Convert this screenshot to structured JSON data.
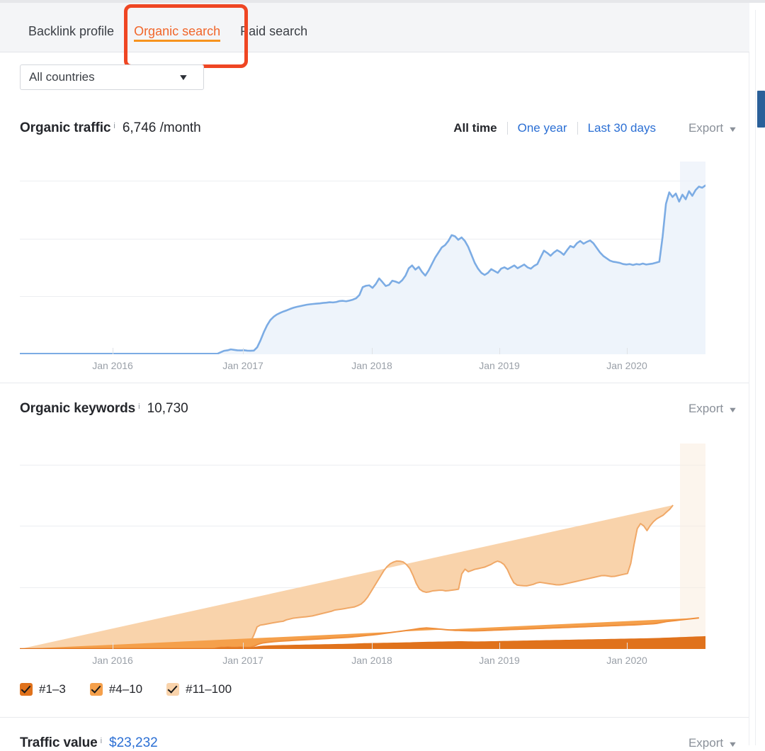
{
  "tabs": [
    {
      "label": "Backlink profile",
      "active": false
    },
    {
      "label": "Organic search",
      "active": true
    },
    {
      "label": "Paid search",
      "active": false
    }
  ],
  "filter": {
    "country_label": "All countries",
    "caret": "▼"
  },
  "traffic_section": {
    "title": "Organic traffic",
    "info": "i",
    "value": "6,746 /month",
    "ranges": [
      {
        "label": "All time",
        "current": true
      },
      {
        "label": "One year",
        "current": false
      },
      {
        "label": "Last 30 days",
        "current": false
      }
    ],
    "export_label": "Export",
    "export_caret": "▼"
  },
  "keywords_section": {
    "title": "Organic keywords",
    "info": "i",
    "value": "10,730",
    "export_label": "Export",
    "export_caret": "▼"
  },
  "traffic_value_section": {
    "title": "Traffic value",
    "info": "i",
    "value": "$23,232",
    "export_label": "Export",
    "export_caret": "▼"
  },
  "legend": [
    {
      "label": "#1–3",
      "color": "#e0721c"
    },
    {
      "label": "#4–10",
      "color": "#f3a košt"
    },
    {
      "label": "#11–100",
      "color": "#f8d4ab"
    }
  ],
  "legend_items": [
    {
      "label": "#1–3",
      "color": "#e0721c"
    },
    {
      "label": "#4–10",
      "color": "#f5a04b"
    },
    {
      "label": "#11–100",
      "color": "#f9d3ab"
    }
  ],
  "colors": {
    "accent_orange": "#f1662a",
    "tab_underline": "#f7931e",
    "annotation_red": "#ef4623",
    "link_blue": "#2b6fd4",
    "traffic_line": "#7cace4",
    "traffic_fill": "#eef4fb",
    "scrollbar_thumb": "#2a6099"
  },
  "chart_data": [
    {
      "type": "area",
      "name": "organic-traffic-chart",
      "title": "Organic traffic",
      "ylabel": "",
      "xlabel": "",
      "ylim": [
        0,
        8333
      ],
      "yticks": [
        "0",
        "2.5K",
        "5.0K",
        "7.5K"
      ],
      "ytick_values": [
        0,
        2500,
        5000,
        7500
      ],
      "xticks": [
        "Jan 2016",
        "Jan 2017",
        "Jan 2018",
        "Jan 2019",
        "Jan 2020"
      ],
      "xtick_positions": [
        0.135,
        0.325,
        0.513,
        0.699,
        0.885
      ],
      "grid": true,
      "legend": "none",
      "series": [
        {
          "name": "Organic traffic",
          "color": "#7cace4",
          "fill": "#eef4fb",
          "values": [
            20,
            20,
            20,
            20,
            20,
            20,
            20,
            20,
            20,
            20,
            20,
            20,
            20,
            20,
            20,
            20,
            20,
            20,
            20,
            20,
            20,
            20,
            20,
            20,
            20,
            20,
            20,
            20,
            20,
            20,
            20,
            20,
            20,
            20,
            20,
            20,
            20,
            20,
            20,
            20,
            20,
            20,
            20,
            20,
            20,
            20,
            20,
            20,
            20,
            20,
            20,
            20,
            20,
            20,
            20,
            20,
            20,
            20,
            20,
            20,
            25,
            90,
            150,
            170,
            210,
            190,
            170,
            165,
            175,
            155,
            150,
            160,
            300,
            600,
            950,
            1250,
            1480,
            1620,
            1720,
            1790,
            1850,
            1900,
            1960,
            2010,
            2050,
            2080,
            2110,
            2140,
            2160,
            2175,
            2190,
            2200,
            2220,
            2230,
            2250,
            2240,
            2260,
            2300,
            2310,
            2290,
            2320,
            2360,
            2420,
            2560,
            2900,
            2960,
            2980,
            2870,
            3040,
            3280,
            3120,
            2950,
            3000,
            3180,
            3140,
            3080,
            3200,
            3400,
            3720,
            3840,
            3660,
            3780,
            3560,
            3400,
            3620,
            3900,
            4180,
            4400,
            4620,
            4720,
            4900,
            5150,
            5100,
            4950,
            5050,
            4900,
            4650,
            4300,
            3950,
            3700,
            3520,
            3430,
            3520,
            3680,
            3600,
            3520,
            3700,
            3760,
            3680,
            3760,
            3840,
            3720,
            3800,
            3880,
            3760,
            3700,
            3820,
            3900,
            4200,
            4480,
            4380,
            4260,
            4400,
            4500,
            4420,
            4300,
            4500,
            4680,
            4620,
            4800,
            4900,
            4780,
            4860,
            4920,
            4800,
            4600,
            4400,
            4250,
            4150,
            4050,
            4000,
            3980,
            3950,
            3900,
            3880,
            3900,
            3860,
            3900,
            3880,
            3920,
            3880,
            3900,
            3920,
            3960,
            4000,
            5100,
            6500,
            7000,
            6800,
            6950,
            6600,
            6900,
            6700,
            7050,
            6850,
            7100,
            7250,
            7200,
            7300
          ]
        }
      ]
    },
    {
      "type": "area",
      "name": "organic-keywords-chart",
      "title": "Organic keywords",
      "stacked": true,
      "ylabel": "",
      "xlabel": "",
      "ylim": [
        0,
        16700
      ],
      "yticks": [
        "0",
        "5.0K",
        "10.0K",
        "15.0K"
      ],
      "ytick_values": [
        0,
        5000,
        10000,
        15000
      ],
      "xticks": [
        "Jan 2016",
        "Jan 2017",
        "Jan 2018",
        "Jan 2019",
        "Jan 2020"
      ],
      "xtick_positions": [
        0.135,
        0.325,
        0.513,
        0.699,
        0.885
      ],
      "grid": true,
      "legend": "bottom",
      "series": [
        {
          "name": "#1–3",
          "color": "#e0721c",
          "values": [
            0,
            0,
            0,
            0,
            0,
            0,
            0,
            0,
            0,
            0,
            0,
            0,
            0,
            0,
            0,
            0,
            0,
            0,
            0,
            0,
            0,
            0,
            0,
            0,
            0,
            0,
            0,
            0,
            0,
            0,
            0,
            0,
            0,
            0,
            0,
            0,
            0,
            0,
            0,
            0,
            0,
            0,
            0,
            0,
            0,
            0,
            0,
            0,
            0,
            0,
            0,
            0,
            0,
            0,
            0,
            0,
            0,
            0,
            0,
            0,
            10,
            40,
            60,
            55,
            70,
            60,
            55,
            60,
            70,
            60,
            55,
            60,
            90,
            140,
            180,
            200,
            210,
            220,
            230,
            240,
            245,
            250,
            255,
            260,
            265,
            270,
            275,
            280,
            285,
            290,
            295,
            300,
            305,
            310,
            315,
            320,
            325,
            330,
            335,
            340,
            345,
            350,
            360,
            370,
            380,
            390,
            400,
            405,
            410,
            415,
            420,
            425,
            430,
            435,
            440,
            445,
            450,
            455,
            460,
            465,
            470,
            480,
            490,
            500,
            505,
            510,
            515,
            520,
            525,
            530,
            535,
            540,
            545,
            550,
            555,
            560,
            560,
            555,
            550,
            545,
            540,
            540,
            545,
            550,
            555,
            560,
            565,
            570,
            575,
            580,
            585,
            590,
            595,
            600,
            605,
            610,
            615,
            620,
            625,
            630,
            635,
            640,
            645,
            650,
            655,
            660,
            665,
            670,
            675,
            680,
            685,
            690,
            695,
            700,
            705,
            710,
            715,
            720,
            725,
            730,
            735,
            740,
            745,
            750,
            755,
            760,
            765,
            770,
            775,
            780,
            785,
            790,
            795,
            800,
            805,
            810,
            820,
            830,
            840,
            850,
            860,
            870,
            880,
            890,
            900,
            910,
            920,
            930,
            940,
            950,
            960,
            970
          ]
        },
        {
          "name": "#4–10",
          "color": "#f5a04b",
          "values": [
            0,
            0,
            0,
            0,
            0,
            0,
            0,
            0,
            0,
            0,
            0,
            0,
            0,
            0,
            0,
            0,
            0,
            0,
            0,
            0,
            0,
            0,
            0,
            0,
            0,
            0,
            0,
            0,
            0,
            0,
            0,
            0,
            0,
            0,
            0,
            0,
            0,
            0,
            0,
            0,
            0,
            0,
            0,
            0,
            0,
            0,
            0,
            0,
            0,
            0,
            0,
            0,
            0,
            0,
            0,
            0,
            0,
            0,
            0,
            0,
            20,
            60,
            90,
            80,
            100,
            90,
            85,
            90,
            100,
            90,
            85,
            90,
            130,
            200,
            260,
            300,
            320,
            340,
            360,
            375,
            390,
            400,
            410,
            420,
            430,
            440,
            450,
            460,
            470,
            480,
            490,
            500,
            510,
            520,
            530,
            540,
            550,
            560,
            570,
            580,
            590,
            600,
            615,
            630,
            645,
            660,
            680,
            700,
            720,
            745,
            770,
            800,
            830,
            860,
            890,
            920,
            950,
            980,
            1010,
            1040,
            1070,
            1100,
            1130,
            1160,
            1180,
            1200,
            1180,
            1150,
            1120,
            1090,
            1060,
            1030,
            1000,
            980,
            960,
            950,
            940,
            935,
            930,
            930,
            935,
            940,
            945,
            950,
            955,
            960,
            965,
            970,
            975,
            980,
            985,
            990,
            995,
            1000,
            1005,
            1010,
            1015,
            1020,
            1025,
            1030,
            1035,
            1040,
            1045,
            1050,
            1055,
            1060,
            1065,
            1070,
            1075,
            1080,
            1085,
            1090,
            1095,
            1100,
            1105,
            1110,
            1115,
            1120,
            1125,
            1130,
            1135,
            1140,
            1145,
            1150,
            1155,
            1160,
            1165,
            1170,
            1175,
            1180,
            1190,
            1200,
            1210,
            1220,
            1230,
            1240,
            1260,
            1300,
            1340,
            1380,
            1400,
            1420,
            1440,
            1460,
            1480,
            1500,
            1520,
            1540,
            1560,
            1580
          ]
        },
        {
          "name": "#11–100",
          "color": "#f9d3ab",
          "values": [
            0,
            0,
            0,
            0,
            0,
            0,
            0,
            0,
            0,
            0,
            0,
            0,
            0,
            0,
            0,
            0,
            0,
            0,
            0,
            0,
            0,
            0,
            0,
            0,
            0,
            0,
            0,
            0,
            0,
            0,
            0,
            0,
            0,
            0,
            0,
            0,
            0,
            0,
            0,
            0,
            0,
            0,
            0,
            0,
            0,
            0,
            0,
            0,
            0,
            0,
            0,
            0,
            0,
            0,
            0,
            0,
            0,
            0,
            0,
            0,
            60,
            260,
            420,
            380,
            470,
            430,
            400,
            420,
            470,
            430,
            400,
            430,
            900,
            1450,
            1500,
            1480,
            1500,
            1520,
            1540,
            1560,
            1580,
            1600,
            1700,
            1750,
            1800,
            1820,
            1840,
            1850,
            1860,
            1880,
            1900,
            1950,
            2000,
            2050,
            2100,
            2150,
            2200,
            2280,
            2300,
            2320,
            2350,
            2380,
            2400,
            2420,
            2500,
            2600,
            2800,
            3100,
            3500,
            3900,
            4300,
            4700,
            5100,
            5400,
            5600,
            5700,
            5750,
            5700,
            5600,
            5350,
            5000,
            4400,
            3700,
            3200,
            3000,
            2900,
            2950,
            3050,
            3100,
            3150,
            3180,
            3150,
            3200,
            3250,
            3300,
            3350,
            4600,
            5000,
            4800,
            4900,
            5000,
            5050,
            5100,
            5150,
            5250,
            5350,
            5500,
            5600,
            5500,
            5300,
            4900,
            4300,
            3800,
            3600,
            3550,
            3520,
            3500,
            3550,
            3600,
            3700,
            3750,
            3700,
            3650,
            3600,
            3550,
            3500,
            3480,
            3500,
            3550,
            3600,
            3650,
            3700,
            3750,
            3800,
            3850,
            3900,
            3950,
            4000,
            4050,
            4100,
            4100,
            4050,
            4000,
            4000,
            4050,
            4100,
            4150,
            4200,
            5000,
            6500,
            7800,
            8200,
            8000,
            7600,
            8000,
            8300,
            8500,
            8600,
            8700,
            8900,
            9100,
            9400
          ]
        }
      ]
    }
  ]
}
